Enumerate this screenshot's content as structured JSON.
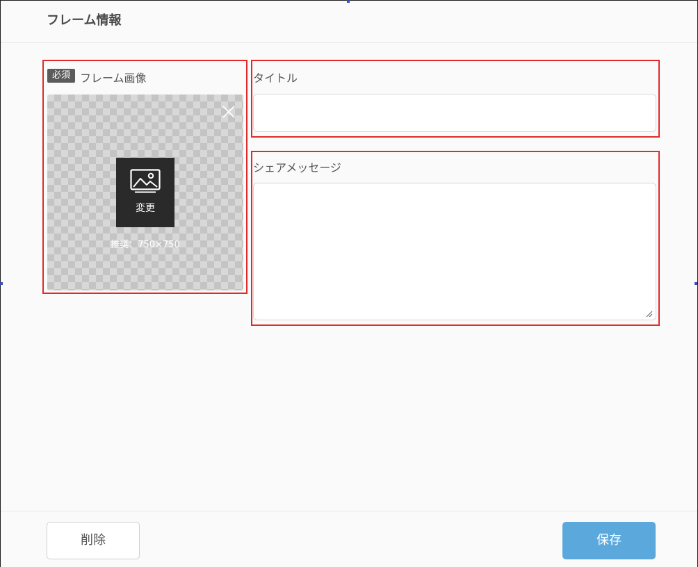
{
  "header": {
    "title": "フレーム情報"
  },
  "frame_image": {
    "required_badge": "必須",
    "label": "フレーム画像",
    "change_label": "変更",
    "recommend_text": "推奨：750×750",
    "close_icon": "close-icon",
    "image_icon": "image-icon"
  },
  "title_field": {
    "label": "タイトル",
    "value": "",
    "placeholder": ""
  },
  "share_message": {
    "label": "シェアメッセージ",
    "value": "",
    "placeholder": ""
  },
  "footer": {
    "delete_label": "削除",
    "save_label": "保存"
  },
  "colors": {
    "highlight_border": "#e02a2a",
    "save_button": "#5aa8dc",
    "badge": "#5b5b5b"
  }
}
